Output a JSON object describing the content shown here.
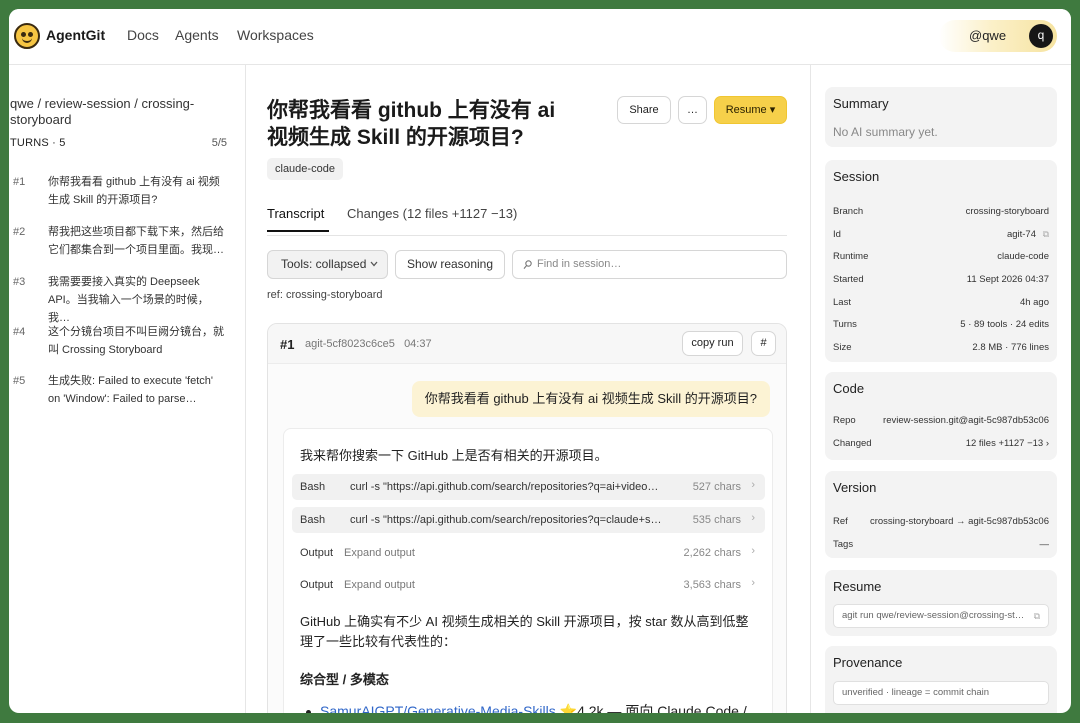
{
  "header": {
    "brand": "AgentGit",
    "nav": [
      "Docs",
      "Agents",
      "Workspaces"
    ],
    "user_handle": "@qwe",
    "avatar_letter": "q"
  },
  "sidebar": {
    "breadcrumb": "qwe / review-session / crossing-storyboard",
    "turns_label": "TURNS · 5",
    "turns_count": "5/5",
    "turns": [
      {
        "num": "#1",
        "text": "你帮我看看 github 上有没有 ai 视频生成 Skill 的开源项目?"
      },
      {
        "num": "#2",
        "text": "帮我把这些项目都下载下来，然后给它们都集合到一个项目里面。我现…"
      },
      {
        "num": "#3",
        "text": "我需要要接入真实的 Deepseek API。当我输入一个场景的时候，我…"
      },
      {
        "num": "#4",
        "text": "这个分镜台项目不叫巨阙分镜台，就叫 Crossing Storyboard"
      },
      {
        "num": "#5",
        "text": "生成失败: Failed to execute 'fetch' on 'Window': Failed to parse…"
      }
    ]
  },
  "main": {
    "title": "你帮我看看 github 上有没有 ai 视频生成 Skill 的开源项目?",
    "share_label": "Share",
    "more_label": "…",
    "resume_label": "Resume ▾",
    "tag": "claude-code",
    "tabs": [
      {
        "label": "Transcript"
      },
      {
        "label": "Changes (12 files +1127 −13)"
      }
    ],
    "tools_select": "Tools: collapsed",
    "show_reasoning": "Show reasoning",
    "search_placeholder": "Find in session…",
    "ref_text": "ref: crossing-storyboard",
    "turn_card": {
      "num": "#1",
      "meta": "agit-5cf8023c6ce5   04:37",
      "copy_run": "copy run",
      "hash_btn": "#",
      "user_message": "你帮我看看 github 上有没有 ai 视频生成 Skill 的开源项目?",
      "intro": "我来帮你搜索一下 GitHub 上是否有相关的开源项目。",
      "tools": [
        {
          "name": "Bash",
          "cmd": "curl -s \"https://api.github.com/search/repositories?q=ai+video…",
          "size": "527 chars"
        },
        {
          "name": "Bash",
          "cmd": "curl -s \"https://api.github.com/search/repositories?q=claude+s…",
          "size": "535 chars"
        }
      ],
      "outputs": [
        {
          "label": "Output",
          "action": "Expand output",
          "size": "2,262 chars"
        },
        {
          "label": "Output",
          "action": "Expand output",
          "size": "3,563 chars"
        }
      ],
      "summary": "GitHub 上确实有不少 AI 视频生成相关的 Skill 开源项目，按 star 数从高到低整理了一些比较有代表性的：",
      "section_heading": "综合型 / 多模态",
      "list_item_link": "SamurAIGPT/Generative-Media-Skills",
      "list_item_rest": "⭐4.2k — 面向 Claude Code /"
    }
  },
  "right": {
    "summary": {
      "title": "Summary",
      "text": "No AI summary yet."
    },
    "session": {
      "title": "Session",
      "rows": [
        {
          "k": "Branch",
          "v": "crossing-storyboard"
        },
        {
          "k": "Id",
          "v": "agit-74"
        },
        {
          "k": "Runtime",
          "v": "claude-code"
        },
        {
          "k": "Started",
          "v": "11 Sept 2026 04:37"
        },
        {
          "k": "Last",
          "v": "4h ago"
        },
        {
          "k": "Turns",
          "v": "5 · 89 tools · 24 edits"
        },
        {
          "k": "Size",
          "v": "2.8 MB · 776 lines"
        }
      ]
    },
    "code": {
      "title": "Code",
      "rows": [
        {
          "k": "Repo",
          "v": "review-session.git@agit-5c987db53c06"
        },
        {
          "k": "Changed",
          "v": "12 files +1127 −13 ›"
        }
      ]
    },
    "version": {
      "title": "Version",
      "rows": [
        {
          "k": "Ref",
          "v": "crossing-storyboard → agit-5c987db53c06"
        },
        {
          "k": "Tags",
          "v": "—"
        }
      ]
    },
    "resume": {
      "title": "Resume",
      "command": "agit run qwe/review-session@crossing-st…"
    },
    "provenance": {
      "title": "Provenance",
      "text": "unverified · lineage = commit chain"
    }
  }
}
